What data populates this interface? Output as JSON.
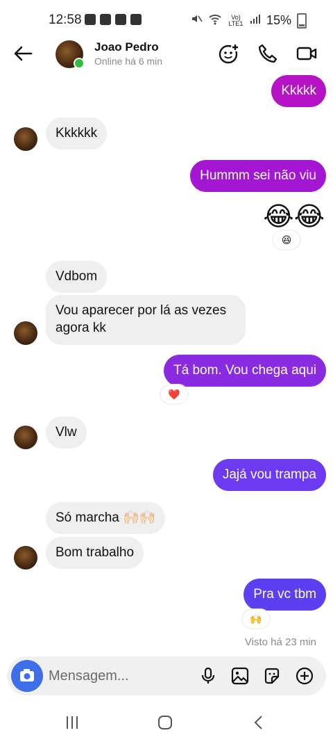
{
  "status_bar": {
    "time": "12:58",
    "battery": "15%",
    "network": "Vo) LTE1"
  },
  "header": {
    "contact_name": "Joao Pedro",
    "contact_status": "Online há 6 min",
    "icons": [
      "back-arrow-icon",
      "add-emoji-icon",
      "phone-icon",
      "video-icon"
    ]
  },
  "messages": {
    "m1": "Kkkkk",
    "m2": "Kkkkkk",
    "m3": "Hummm sei não viu",
    "m4": "😂😂",
    "m4_reaction": "😆",
    "m5": "Vdbom",
    "m6": "Vou aparecer por lá as vezes agora kk",
    "m7": "Tá bom. Vou chega aqui",
    "m7_reaction": "❤️",
    "m8": "Vlw",
    "m9": "Jajá vou trampa",
    "m10": "Só marcha 🙌🏻🙌🏻",
    "m11": "Bom trabalho",
    "m12": "Pra vc tbm",
    "m12_reaction": "🙌"
  },
  "seen_text": "Visto há 23 min",
  "composer": {
    "placeholder": "Mensagem..."
  },
  "colors": {
    "outgoing_top": "#b613c7",
    "outgoing_mid": "#8a2be2",
    "outgoing_bottom": "#5b3ff0",
    "incoming": "#efefef",
    "camera_button": "#3f6fe8",
    "online_dot": "#2fbf3a"
  }
}
